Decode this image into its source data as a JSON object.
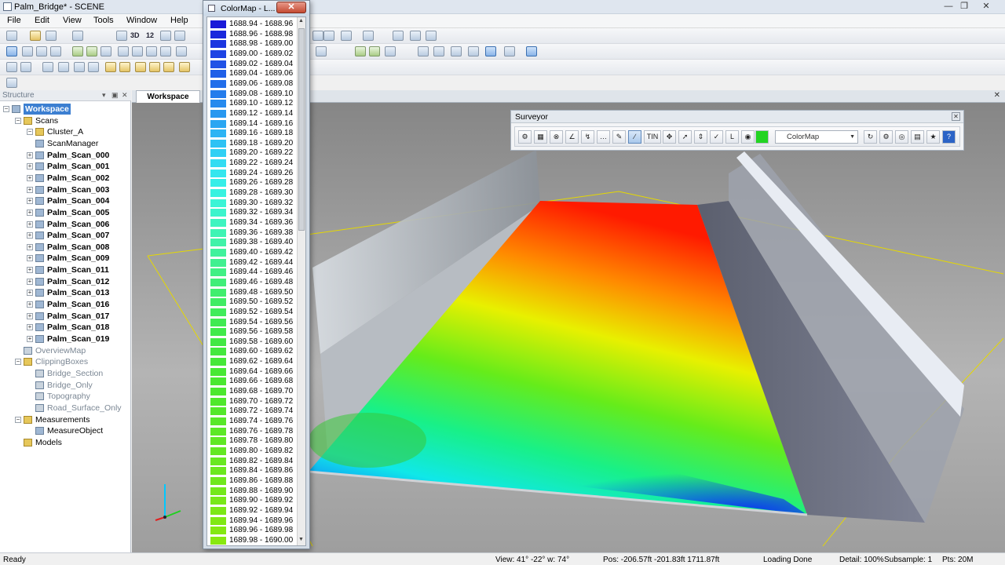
{
  "window": {
    "title": "Palm_Bridge* - SCENE"
  },
  "menu": [
    "File",
    "Edit",
    "View",
    "Tools",
    "Window",
    "Help"
  ],
  "toolbar": {
    "label_3d": "3D",
    "label_12": "12"
  },
  "structure": {
    "title": "Structure",
    "items": [
      {
        "label": "Workspace",
        "level": 0,
        "expander": "minus",
        "style": "sel",
        "icon": "workspace-icon"
      },
      {
        "label": "Scans",
        "level": 1,
        "expander": "minus",
        "style": "",
        "icon": "scans-icon"
      },
      {
        "label": "Cluster_A",
        "level": 2,
        "expander": "minus",
        "style": "",
        "icon": "cluster-icon"
      },
      {
        "label": "ScanManager",
        "level": 3,
        "expander": "",
        "style": "",
        "icon": "scanmanager-icon"
      },
      {
        "label": "Palm_Scan_000",
        "level": 3,
        "expander": "plus",
        "style": "bold",
        "icon": "scan-icon"
      },
      {
        "label": "Palm_Scan_001",
        "level": 3,
        "expander": "plus",
        "style": "bold",
        "icon": "scan-icon"
      },
      {
        "label": "Palm_Scan_002",
        "level": 3,
        "expander": "plus",
        "style": "bold",
        "icon": "scan-icon"
      },
      {
        "label": "Palm_Scan_003",
        "level": 3,
        "expander": "plus",
        "style": "bold",
        "icon": "scan-icon"
      },
      {
        "label": "Palm_Scan_004",
        "level": 3,
        "expander": "plus",
        "style": "bold",
        "icon": "scan-icon"
      },
      {
        "label": "Palm_Scan_005",
        "level": 3,
        "expander": "plus",
        "style": "bold",
        "icon": "scan-icon"
      },
      {
        "label": "Palm_Scan_006",
        "level": 3,
        "expander": "plus",
        "style": "bold",
        "icon": "scan-icon"
      },
      {
        "label": "Palm_Scan_007",
        "level": 3,
        "expander": "plus",
        "style": "bold",
        "icon": "scan-icon"
      },
      {
        "label": "Palm_Scan_008",
        "level": 3,
        "expander": "plus",
        "style": "bold",
        "icon": "scan-icon"
      },
      {
        "label": "Palm_Scan_009",
        "level": 3,
        "expander": "plus",
        "style": "bold",
        "icon": "scan-icon"
      },
      {
        "label": "Palm_Scan_011",
        "level": 3,
        "expander": "plus",
        "style": "bold",
        "icon": "scan-icon"
      },
      {
        "label": "Palm_Scan_012",
        "level": 3,
        "expander": "plus",
        "style": "bold",
        "icon": "scan-icon"
      },
      {
        "label": "Palm_Scan_013",
        "level": 3,
        "expander": "plus",
        "style": "bold",
        "icon": "scan-icon"
      },
      {
        "label": "Palm_Scan_016",
        "level": 3,
        "expander": "plus",
        "style": "bold",
        "icon": "scan-icon"
      },
      {
        "label": "Palm_Scan_017",
        "level": 3,
        "expander": "plus",
        "style": "bold",
        "icon": "scan-icon"
      },
      {
        "label": "Palm_Scan_018",
        "level": 3,
        "expander": "plus",
        "style": "bold",
        "icon": "scan-icon"
      },
      {
        "label": "Palm_Scan_019",
        "level": 3,
        "expander": "plus",
        "style": "bold",
        "icon": "scan-icon"
      },
      {
        "label": "OverviewMap",
        "level": 1,
        "expander": "",
        "style": "dim",
        "icon": "overviewmap-icon"
      },
      {
        "label": "ClippingBoxes",
        "level": 1,
        "expander": "minus",
        "style": "dim",
        "icon": "folder-icon"
      },
      {
        "label": "Bridge_Section",
        "level": 2,
        "expander": "",
        "style": "dim",
        "icon": "clippingbox-icon"
      },
      {
        "label": "Bridge_Only",
        "level": 2,
        "expander": "",
        "style": "dim",
        "icon": "clippingbox-icon"
      },
      {
        "label": "Topography",
        "level": 2,
        "expander": "",
        "style": "dim",
        "icon": "clippingbox-icon"
      },
      {
        "label": "Road_Surface_Only",
        "level": 2,
        "expander": "",
        "style": "dim",
        "icon": "clippingbox-icon"
      },
      {
        "label": "Measurements",
        "level": 1,
        "expander": "minus",
        "style": "",
        "icon": "folder-icon"
      },
      {
        "label": "MeasureObject",
        "level": 2,
        "expander": "",
        "style": "",
        "icon": "measure-icon"
      },
      {
        "label": "Models",
        "level": 1,
        "expander": "",
        "style": "",
        "icon": "folder-icon"
      }
    ]
  },
  "tabs": {
    "workspace": "Workspace"
  },
  "colormap": {
    "title": "ColorMap - L...",
    "legend": [
      {
        "label": "1688.94 - 1688.96",
        "color": "#1a1ad8"
      },
      {
        "label": "1688.96 - 1688.98",
        "color": "#1a28dc"
      },
      {
        "label": "1688.98 - 1689.00",
        "color": "#1c36e0"
      },
      {
        "label": "1689.00 - 1689.02",
        "color": "#1e44e4"
      },
      {
        "label": "1689.02 - 1689.04",
        "color": "#2052e6"
      },
      {
        "label": "1689.04 - 1689.06",
        "color": "#2060e8"
      },
      {
        "label": "1689.06 - 1689.08",
        "color": "#226eea"
      },
      {
        "label": "1689.08 - 1689.10",
        "color": "#247cec"
      },
      {
        "label": "1689.10 - 1689.12",
        "color": "#268aee"
      },
      {
        "label": "1689.12 - 1689.14",
        "color": "#2898f0"
      },
      {
        "label": "1689.14 - 1689.16",
        "color": "#2aa6f2"
      },
      {
        "label": "1689.16 - 1689.18",
        "color": "#2cb4f4"
      },
      {
        "label": "1689.18 - 1689.20",
        "color": "#2ec2f4"
      },
      {
        "label": "1689.20 - 1689.22",
        "color": "#30d0f4"
      },
      {
        "label": "1689.22 - 1689.24",
        "color": "#32dcf2"
      },
      {
        "label": "1689.24 - 1689.26",
        "color": "#34e6ee"
      },
      {
        "label": "1689.26 - 1689.28",
        "color": "#36eee8"
      },
      {
        "label": "1689.28 - 1689.30",
        "color": "#38f2e0"
      },
      {
        "label": "1689.30 - 1689.32",
        "color": "#3af4d6"
      },
      {
        "label": "1689.32 - 1689.34",
        "color": "#3cf4cc"
      },
      {
        "label": "1689.34 - 1689.36",
        "color": "#3ef4c0"
      },
      {
        "label": "1689.36 - 1689.38",
        "color": "#3ef4b4"
      },
      {
        "label": "1689.38 - 1689.40",
        "color": "#40f2a8"
      },
      {
        "label": "1689.40 - 1689.42",
        "color": "#40f29c"
      },
      {
        "label": "1689.42 - 1689.44",
        "color": "#40f090"
      },
      {
        "label": "1689.44 - 1689.46",
        "color": "#40f084"
      },
      {
        "label": "1689.46 - 1689.48",
        "color": "#40ee78"
      },
      {
        "label": "1689.48 - 1689.50",
        "color": "#40ee6e"
      },
      {
        "label": "1689.50 - 1689.52",
        "color": "#40ec64"
      },
      {
        "label": "1689.52 - 1689.54",
        "color": "#40ec5a"
      },
      {
        "label": "1689.54 - 1689.56",
        "color": "#40ea52"
      },
      {
        "label": "1689.56 - 1689.58",
        "color": "#40ea4a"
      },
      {
        "label": "1689.58 - 1689.60",
        "color": "#42e844"
      },
      {
        "label": "1689.60 - 1689.62",
        "color": "#44e83e"
      },
      {
        "label": "1689.62 - 1689.64",
        "color": "#46e838"
      },
      {
        "label": "1689.64 - 1689.66",
        "color": "#48e834"
      },
      {
        "label": "1689.66 - 1689.68",
        "color": "#4ae830"
      },
      {
        "label": "1689.68 - 1689.70",
        "color": "#4ce82e"
      },
      {
        "label": "1689.70 - 1689.72",
        "color": "#50e82c"
      },
      {
        "label": "1689.72 - 1689.74",
        "color": "#54e82a"
      },
      {
        "label": "1689.74 - 1689.76",
        "color": "#58e828"
      },
      {
        "label": "1689.76 - 1689.78",
        "color": "#5ce826"
      },
      {
        "label": "1689.78 - 1689.80",
        "color": "#60e824"
      },
      {
        "label": "1689.80 - 1689.82",
        "color": "#64e822"
      },
      {
        "label": "1689.82 - 1689.84",
        "color": "#68e820"
      },
      {
        "label": "1689.84 - 1689.86",
        "color": "#6ce81e"
      },
      {
        "label": "1689.86 - 1689.88",
        "color": "#70e81c"
      },
      {
        "label": "1689.88 - 1689.90",
        "color": "#74e81a"
      },
      {
        "label": "1689.90 - 1689.92",
        "color": "#78e818"
      },
      {
        "label": "1689.92 - 1689.94",
        "color": "#7ce816"
      },
      {
        "label": "1689.94 - 1689.96",
        "color": "#80e814"
      },
      {
        "label": "1689.96 - 1689.98",
        "color": "#84e812"
      },
      {
        "label": "1689.98 - 1690.00",
        "color": "#88e810"
      }
    ]
  },
  "surveyor": {
    "title": "Surveyor",
    "combo_value": "ColorMap",
    "tin_label": "TIN",
    "l_label": "L"
  },
  "status": {
    "left": "Ready",
    "view": "View: 41° -22° w: 74°",
    "pos": "Pos: -206.57ft -201.83ft 1711.87ft",
    "loading": "Loading Done",
    "detail": "Detail: 100%",
    "subsample": "Subsample:  1",
    "pts": "Pts: 20M"
  },
  "colors": {
    "accent": "#3c7fd1",
    "selection": "#3c7fd1"
  }
}
